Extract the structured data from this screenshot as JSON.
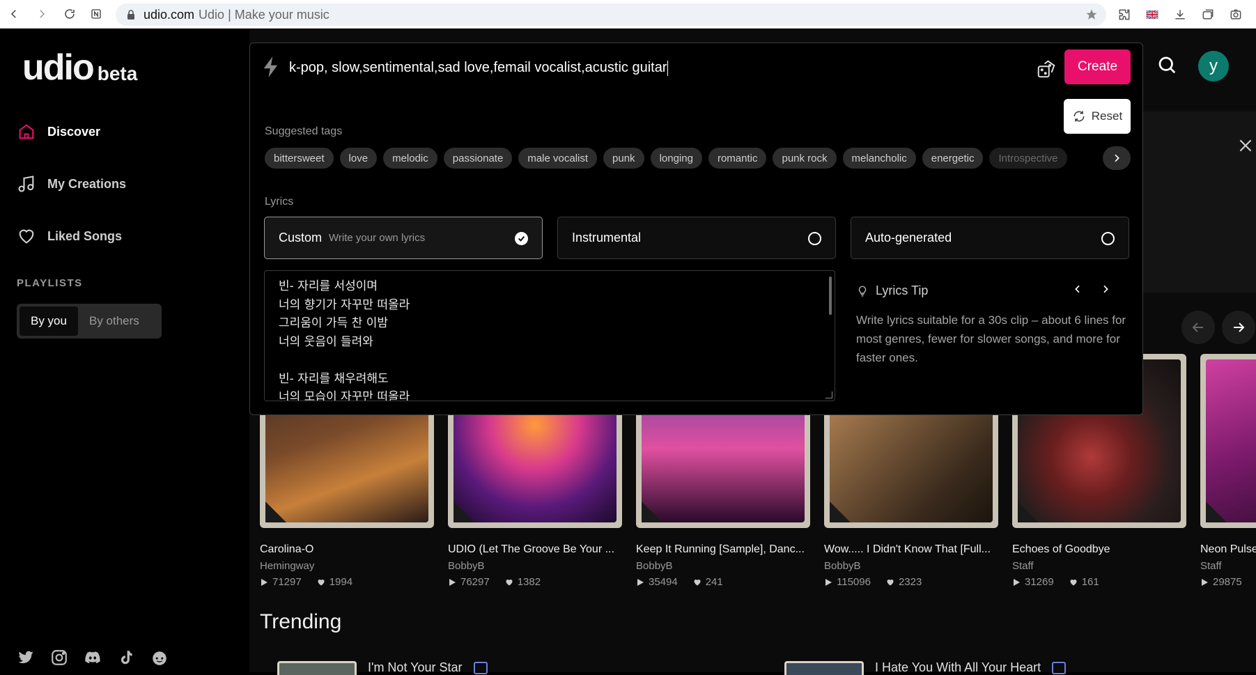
{
  "browser": {
    "url_domain": "udio.com",
    "url_title": "Udio | Make your music"
  },
  "sidebar": {
    "logo_main": "udio",
    "logo_beta": "beta",
    "nav": [
      {
        "label": "Discover",
        "icon": "home-icon"
      },
      {
        "label": "My Creations",
        "icon": "music-note-icon"
      },
      {
        "label": "Liked Songs",
        "icon": "heart-icon"
      }
    ],
    "playlists_label": "PLAYLISTS",
    "playlist_tabs": [
      "By you",
      "By others"
    ]
  },
  "header": {
    "avatar_letter": "y"
  },
  "create_panel": {
    "prompt": "k-pop, slow,sentimental,sad love,femail vocalist,acustic guitar",
    "create_label": "Create",
    "reset_label": "Reset",
    "suggested_tags_label": "Suggested tags",
    "tags": [
      "bittersweet",
      "love",
      "melodic",
      "passionate",
      "male vocalist",
      "punk",
      "longing",
      "romantic",
      "punk rock",
      "melancholic",
      "energetic",
      "Introspective"
    ],
    "lyrics_label": "Lyrics",
    "lyric_options": [
      {
        "title": "Custom",
        "subtitle": "Write your own lyrics",
        "selected": true
      },
      {
        "title": "Instrumental",
        "subtitle": "",
        "selected": false
      },
      {
        "title": "Auto-generated",
        "subtitle": "",
        "selected": false
      }
    ],
    "lyrics_lines": [
      "빈- 자리를 서성이며",
      "너의 향기가 자꾸만 떠올라",
      "그리움이 가득 찬 이밤",
      "너의 웃음이 들려와",
      "",
      "빈- 자리를 채우려해도",
      "너의 모습이 자꾸만 떠올라"
    ],
    "tip_title": "Lyrics Tip",
    "tip_body": "Write lyrics suitable for a 30s clip – about 6 lines for most genres, fewer for slower songs, and more for faster ones."
  },
  "cards": [
    {
      "title": "Carolina-O",
      "artist": "Hemingway",
      "plays": "71297",
      "likes": "1994",
      "color_a": "#3a2a22",
      "color_b": "#c7803a"
    },
    {
      "title": "UDIO (Let The Groove Be Your ...",
      "artist": "BobbyB",
      "plays": "76297",
      "likes": "1382",
      "color_a": "#2b0b4a",
      "color_b": "#d83a8c"
    },
    {
      "title": "Keep It Running [Sample], Danc...",
      "artist": "BobbyB",
      "plays": "35494",
      "likes": "241",
      "color_a": "#3b0f3b",
      "color_b": "#e050a0"
    },
    {
      "title": "Wow..... I Didn't Know That [Full...",
      "artist": "BobbyB",
      "plays": "115096",
      "likes": "2323",
      "color_a": "#3a2a1c",
      "color_b": "#c89060"
    },
    {
      "title": "Echoes of Goodbye",
      "artist": "Staff",
      "plays": "31269",
      "likes": "161",
      "color_a": "#1e1a1a",
      "color_b": "#8a2a2a"
    },
    {
      "title": "Neon Pulse",
      "artist": "Staff",
      "plays": "29875",
      "likes": "",
      "color_a": "#2a0a2a",
      "color_b": "#d040a0"
    }
  ],
  "trending": {
    "title": "Trending",
    "items": [
      "I'm Not Your Star",
      "I Hate You With All Your Heart"
    ]
  }
}
